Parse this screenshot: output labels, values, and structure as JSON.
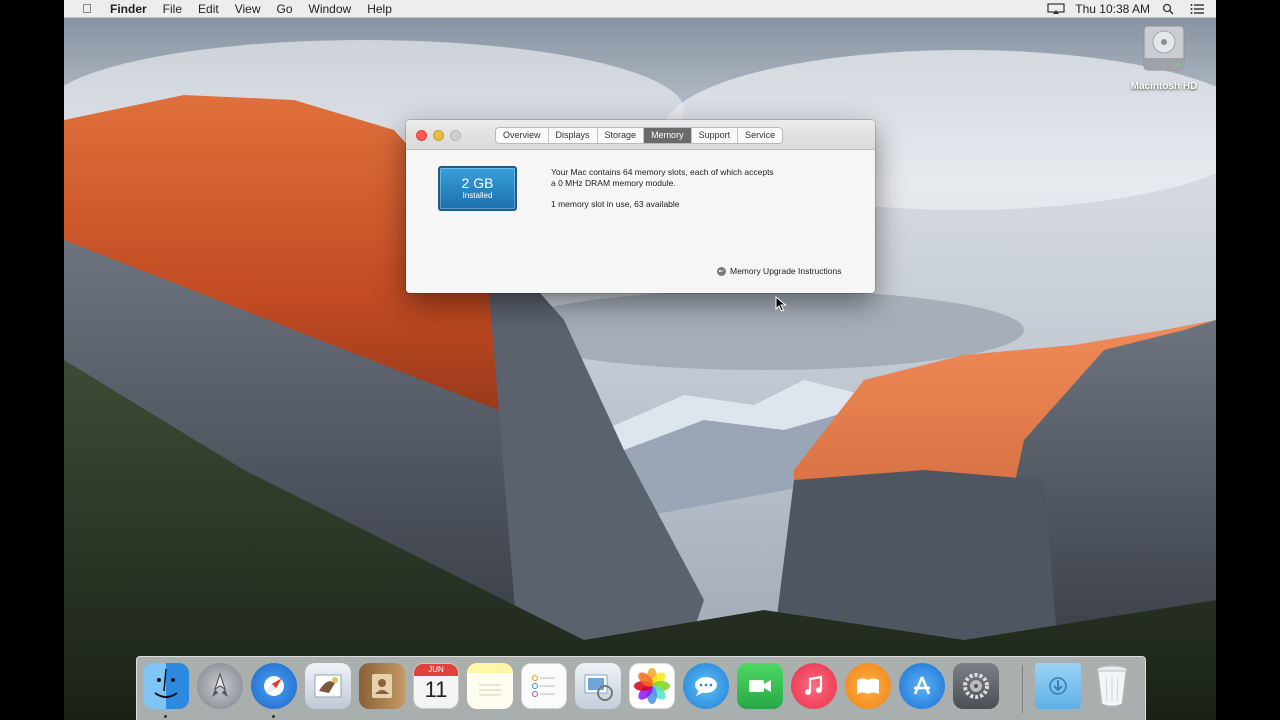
{
  "menubar": {
    "apple_icon": "apple-icon",
    "app_name": "Finder",
    "menus": [
      "File",
      "Edit",
      "View",
      "Go",
      "Window",
      "Help"
    ],
    "clock": "Thu 10:38 AM",
    "status_icons": [
      "airplay-icon",
      "search-icon",
      "notification-list-icon"
    ]
  },
  "desktop": {
    "hd_label": "Macintosh HD"
  },
  "about_window": {
    "tabs": [
      "Overview",
      "Displays",
      "Storage",
      "Memory",
      "Support",
      "Service"
    ],
    "active_tab": "Memory",
    "memory_size": "2 GB",
    "memory_status": "Installed",
    "info_line1": "Your Mac contains 64 memory slots, each of which accepts",
    "info_line2": "a 0 MHz DRAM memory module.",
    "slots_text": "1 memory slot in use, 63 available",
    "upgrade_link": "Memory Upgrade Instructions"
  },
  "dock": {
    "apps": [
      {
        "name": "Finder",
        "icon": "finder-icon",
        "color": "#3c9be8",
        "running": true
      },
      {
        "name": "Launchpad",
        "icon": "launchpad-icon",
        "color": "#8c9199",
        "running": false
      },
      {
        "name": "Safari",
        "icon": "safari-icon",
        "color": "#2f87e6",
        "running": true
      },
      {
        "name": "Mail",
        "icon": "mail-icon",
        "color": "#d9dfe8",
        "running": false
      },
      {
        "name": "Contacts",
        "icon": "contacts-icon",
        "color": "#b88a52",
        "running": false
      },
      {
        "name": "Calendar",
        "icon": "calendar-icon",
        "color": "#f4f4f4",
        "running": false
      },
      {
        "name": "Notes",
        "icon": "notes-icon",
        "color": "#f7e56b",
        "running": false
      },
      {
        "name": "Reminders",
        "icon": "reminders-icon",
        "color": "#f8f8f8",
        "running": false
      },
      {
        "name": "Preview",
        "icon": "preview-icon",
        "color": "#e0e6ee",
        "running": false
      },
      {
        "name": "Photos",
        "icon": "photos-icon",
        "color": "#ffffff",
        "running": false
      },
      {
        "name": "Messages",
        "icon": "messages-icon",
        "color": "#43a6ea",
        "running": false
      },
      {
        "name": "FaceTime",
        "icon": "facetime-icon",
        "color": "#36c24a",
        "running": false
      },
      {
        "name": "iTunes",
        "icon": "itunes-icon",
        "color": "#ee3a55",
        "running": false
      },
      {
        "name": "iBooks",
        "icon": "ibooks-icon",
        "color": "#f08a1e",
        "running": false
      },
      {
        "name": "App Store",
        "icon": "app-store-icon",
        "color": "#2f8ee8",
        "running": false
      },
      {
        "name": "System Preferences",
        "icon": "system-preferences-icon",
        "color": "#6d7178",
        "running": false
      },
      {
        "name": "Downloads",
        "icon": "downloads-folder-icon",
        "color": "#79c3ee",
        "running": false
      },
      {
        "name": "Trash",
        "icon": "trash-icon",
        "color": "#e9edf1",
        "running": false
      }
    ],
    "calendar_month": "JUN",
    "calendar_day": "11"
  }
}
